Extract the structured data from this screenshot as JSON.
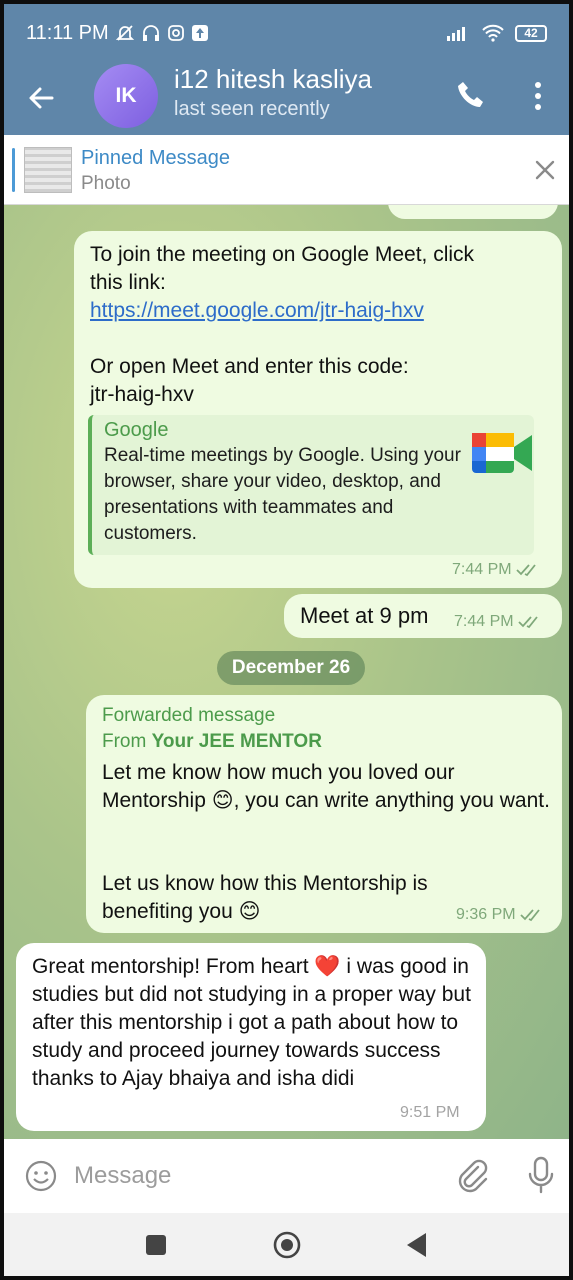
{
  "status_bar": {
    "time": "11:11 PM",
    "battery": "42"
  },
  "header": {
    "avatar_initials": "IK",
    "contact_name": "i12 hitesh kasliya",
    "last_seen": "last seen recently"
  },
  "pinned": {
    "title": "Pinned Message",
    "subtitle": "Photo"
  },
  "messages": [
    {
      "type": "outgoing",
      "line1": "To join the meeting on Google Meet, click",
      "line2": "this link:",
      "link": "https://meet.google.com/jtr-haig-hxv",
      "line3": "Or open Meet and enter this code:",
      "line4": "jtr-haig-hxv",
      "preview_site": "Google",
      "preview_desc": "Real-time meetings by Google. Using your browser, share your video, desktop, and presentations with teammates and customers.",
      "time": "7:44 PM"
    },
    {
      "type": "outgoing",
      "text": "Meet at 9 pm",
      "time": "7:44 PM"
    },
    {
      "type": "date",
      "text": "December 26"
    },
    {
      "type": "outgoing",
      "forward_label": "Forwarded message",
      "forward_from_prefix": "From ",
      "forward_from": "Your JEE MENTOR",
      "para1": "Let me know how much you loved our Mentorship 😊, you can write anything you want.",
      "para2": "Let us know how this Mentorship is benefiting you 😊",
      "time": "9:36 PM"
    },
    {
      "type": "incoming",
      "text": "Great mentorship! From heart ❤️ i was good in studies but did not studying in a proper way but after this mentorship i got a path about how to study and proceed journey towards success thanks to Ajay bhaiya and isha didi",
      "time": "9:51 PM"
    }
  ],
  "input": {
    "placeholder": "Message"
  },
  "colors": {
    "header_bg": "#5f86a9",
    "outgoing_bubble": "#effbe1",
    "incoming_bubble": "#ffffff",
    "accent_green": "#4c9b4b",
    "link_blue": "#2d6cc9"
  }
}
